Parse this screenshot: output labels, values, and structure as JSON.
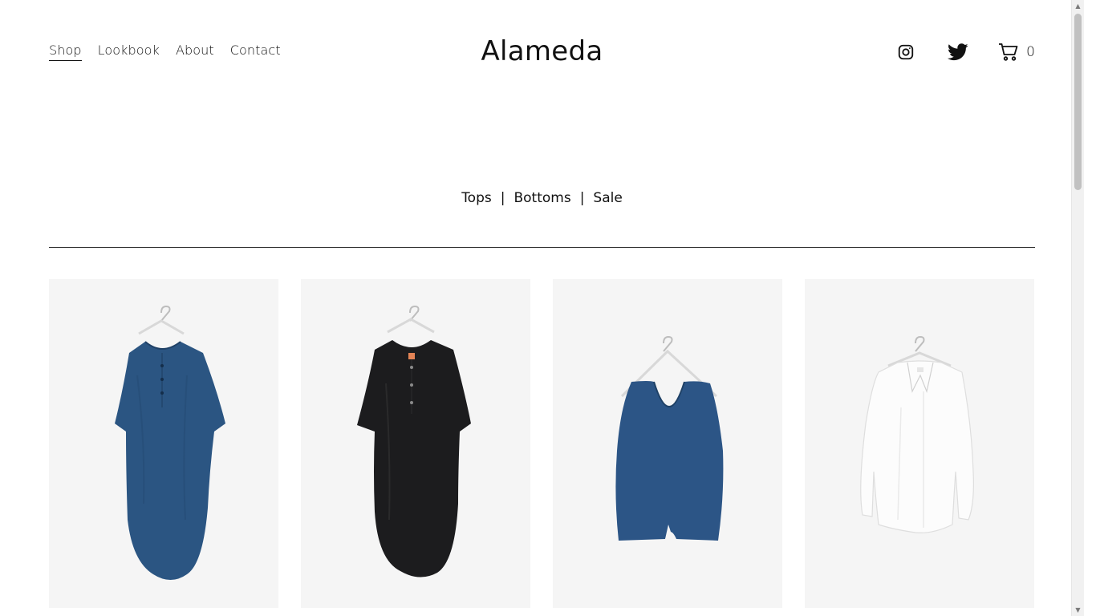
{
  "header": {
    "nav": [
      {
        "label": "Shop",
        "active": true
      },
      {
        "label": "Lookbook",
        "active": false
      },
      {
        "label": "About",
        "active": false
      },
      {
        "label": "Contact",
        "active": false
      }
    ],
    "brand": "Alameda",
    "icons": [
      "instagram-icon",
      "twitter-icon",
      "cart-icon"
    ],
    "cart_count": "0"
  },
  "categories": {
    "items": [
      "Tops",
      "Bottoms",
      "Sale"
    ],
    "separator": "|"
  },
  "products": [
    {
      "garment": "blue-tunic-dress",
      "color": "#2b5582"
    },
    {
      "garment": "black-tunic-dress",
      "color": "#1c1c1e"
    },
    {
      "garment": "blue-tank-top",
      "color": "#2c5586"
    },
    {
      "garment": "white-shirt",
      "color": "#f7f7f7"
    }
  ],
  "colors": {
    "text": "#111111",
    "card_bg": "#f5f5f5",
    "divider": "#333333"
  }
}
